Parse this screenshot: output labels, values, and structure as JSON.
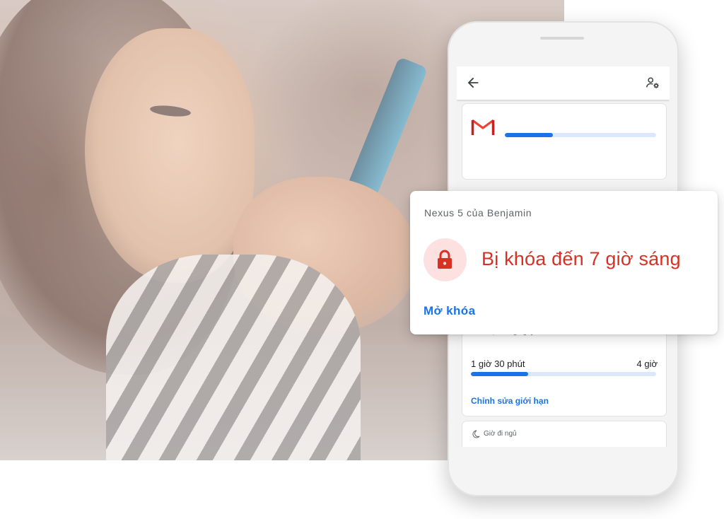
{
  "phone": {
    "toolbar": {
      "back_icon": "arrow-left-icon",
      "settings_icon": "account-settings-icon"
    },
    "app_card": {
      "app_icon": "gmail-icon",
      "usage_fraction": 0.32
    },
    "daily_limit_card": {
      "header": "Giới hạn hằng ngày",
      "current": "1 giờ 30 phút",
      "limit": "4 giờ",
      "progress_fraction": 0.31,
      "edit_label": "Chỉnh sửa giới hạn"
    },
    "bedtime_card": {
      "label": "Giờ đi ngủ"
    }
  },
  "popup": {
    "device_name": "Nexus 5 của Benjamin",
    "status": "Bị khóa đến 7 giờ sáng",
    "unlock_label": "Mở khóa",
    "lock_icon": "lock-icon"
  },
  "colors": {
    "accent": "#1a73e8",
    "locked": "#d93025",
    "lock_badge_bg": "#fce1e0",
    "progress_track": "#dbe7fb"
  }
}
